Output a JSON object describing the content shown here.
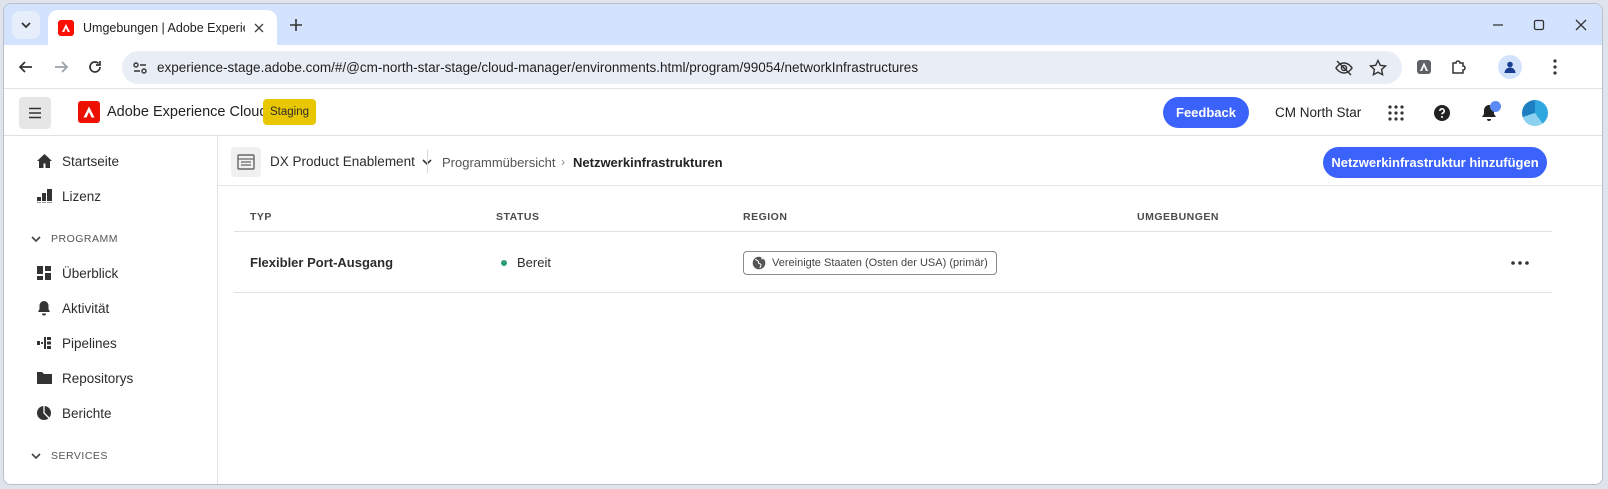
{
  "browser": {
    "tab_title": "Umgebungen | Adobe Experien",
    "url": "experience-stage.adobe.com/#/@cm-north-star-stage/cloud-manager/environments.html/program/99054/networkInfrastructures"
  },
  "header": {
    "brand": "Adobe Experience Cloud",
    "env_badge": "Staging",
    "feedback_label": "Feedback",
    "org_name": "CM North Star"
  },
  "sidebar": {
    "items": [
      {
        "label": "Startseite"
      },
      {
        "label": "Lizenz"
      }
    ],
    "section_program": "PROGRAMM",
    "program_items": [
      {
        "label": "Überblick"
      },
      {
        "label": "Aktivität"
      },
      {
        "label": "Pipelines"
      },
      {
        "label": "Repositorys"
      },
      {
        "label": "Berichte"
      }
    ],
    "section_services": "SERVICES"
  },
  "breadcrumb": {
    "program": "DX Product Enablement",
    "parent": "Programmübersicht",
    "current": "Netzwerkinfrastrukturen"
  },
  "actions": {
    "add_label": "Netzwerkinfrastruktur hinzufügen"
  },
  "table": {
    "columns": [
      "TYP",
      "STATUS",
      "REGION",
      "UMGEBUNGEN"
    ],
    "rows": [
      {
        "type": "Flexibler Port-Ausgang",
        "status": "Bereit",
        "region": "Vereinigte Staaten (Osten der USA) (primär)",
        "environments": ""
      }
    ]
  },
  "colors": {
    "accent": "#3b63fb",
    "adobe_red": "#eb1000",
    "staging_yellow": "#e8c600",
    "status_ready": "#2d9d78",
    "tabstrip": "#d3e3fd"
  }
}
